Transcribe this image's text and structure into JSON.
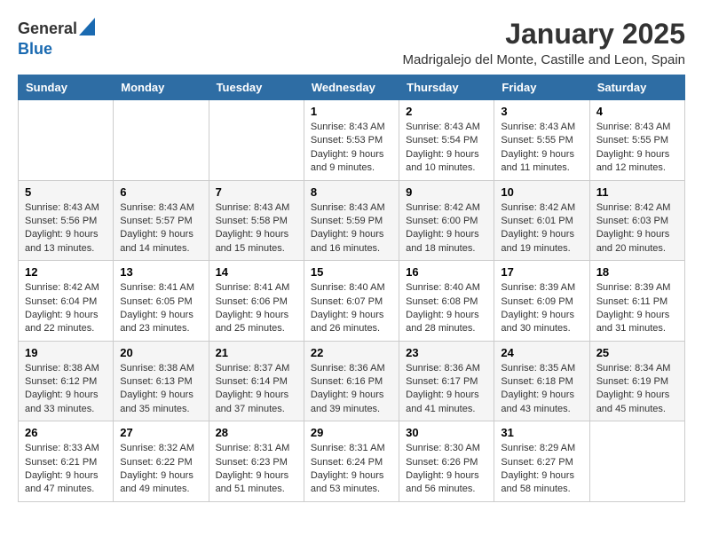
{
  "logo": {
    "general": "General",
    "blue": "Blue"
  },
  "title": "January 2025",
  "subtitle": "Madrigalejo del Monte, Castille and Leon, Spain",
  "weekdays": [
    "Sunday",
    "Monday",
    "Tuesday",
    "Wednesday",
    "Thursday",
    "Friday",
    "Saturday"
  ],
  "weeks": [
    {
      "rowClass": "row-normal",
      "days": [
        {
          "date": "",
          "info": ""
        },
        {
          "date": "",
          "info": ""
        },
        {
          "date": "",
          "info": ""
        },
        {
          "date": "1",
          "info": "Sunrise: 8:43 AM\nSunset: 5:53 PM\nDaylight: 9 hours and 9 minutes."
        },
        {
          "date": "2",
          "info": "Sunrise: 8:43 AM\nSunset: 5:54 PM\nDaylight: 9 hours and 10 minutes."
        },
        {
          "date": "3",
          "info": "Sunrise: 8:43 AM\nSunset: 5:55 PM\nDaylight: 9 hours and 11 minutes."
        },
        {
          "date": "4",
          "info": "Sunrise: 8:43 AM\nSunset: 5:55 PM\nDaylight: 9 hours and 12 minutes."
        }
      ]
    },
    {
      "rowClass": "row-alt",
      "days": [
        {
          "date": "5",
          "info": "Sunrise: 8:43 AM\nSunset: 5:56 PM\nDaylight: 9 hours and 13 minutes."
        },
        {
          "date": "6",
          "info": "Sunrise: 8:43 AM\nSunset: 5:57 PM\nDaylight: 9 hours and 14 minutes."
        },
        {
          "date": "7",
          "info": "Sunrise: 8:43 AM\nSunset: 5:58 PM\nDaylight: 9 hours and 15 minutes."
        },
        {
          "date": "8",
          "info": "Sunrise: 8:43 AM\nSunset: 5:59 PM\nDaylight: 9 hours and 16 minutes."
        },
        {
          "date": "9",
          "info": "Sunrise: 8:42 AM\nSunset: 6:00 PM\nDaylight: 9 hours and 18 minutes."
        },
        {
          "date": "10",
          "info": "Sunrise: 8:42 AM\nSunset: 6:01 PM\nDaylight: 9 hours and 19 minutes."
        },
        {
          "date": "11",
          "info": "Sunrise: 8:42 AM\nSunset: 6:03 PM\nDaylight: 9 hours and 20 minutes."
        }
      ]
    },
    {
      "rowClass": "row-normal",
      "days": [
        {
          "date": "12",
          "info": "Sunrise: 8:42 AM\nSunset: 6:04 PM\nDaylight: 9 hours and 22 minutes."
        },
        {
          "date": "13",
          "info": "Sunrise: 8:41 AM\nSunset: 6:05 PM\nDaylight: 9 hours and 23 minutes."
        },
        {
          "date": "14",
          "info": "Sunrise: 8:41 AM\nSunset: 6:06 PM\nDaylight: 9 hours and 25 minutes."
        },
        {
          "date": "15",
          "info": "Sunrise: 8:40 AM\nSunset: 6:07 PM\nDaylight: 9 hours and 26 minutes."
        },
        {
          "date": "16",
          "info": "Sunrise: 8:40 AM\nSunset: 6:08 PM\nDaylight: 9 hours and 28 minutes."
        },
        {
          "date": "17",
          "info": "Sunrise: 8:39 AM\nSunset: 6:09 PM\nDaylight: 9 hours and 30 minutes."
        },
        {
          "date": "18",
          "info": "Sunrise: 8:39 AM\nSunset: 6:11 PM\nDaylight: 9 hours and 31 minutes."
        }
      ]
    },
    {
      "rowClass": "row-alt",
      "days": [
        {
          "date": "19",
          "info": "Sunrise: 8:38 AM\nSunset: 6:12 PM\nDaylight: 9 hours and 33 minutes."
        },
        {
          "date": "20",
          "info": "Sunrise: 8:38 AM\nSunset: 6:13 PM\nDaylight: 9 hours and 35 minutes."
        },
        {
          "date": "21",
          "info": "Sunrise: 8:37 AM\nSunset: 6:14 PM\nDaylight: 9 hours and 37 minutes."
        },
        {
          "date": "22",
          "info": "Sunrise: 8:36 AM\nSunset: 6:16 PM\nDaylight: 9 hours and 39 minutes."
        },
        {
          "date": "23",
          "info": "Sunrise: 8:36 AM\nSunset: 6:17 PM\nDaylight: 9 hours and 41 minutes."
        },
        {
          "date": "24",
          "info": "Sunrise: 8:35 AM\nSunset: 6:18 PM\nDaylight: 9 hours and 43 minutes."
        },
        {
          "date": "25",
          "info": "Sunrise: 8:34 AM\nSunset: 6:19 PM\nDaylight: 9 hours and 45 minutes."
        }
      ]
    },
    {
      "rowClass": "row-normal",
      "days": [
        {
          "date": "26",
          "info": "Sunrise: 8:33 AM\nSunset: 6:21 PM\nDaylight: 9 hours and 47 minutes."
        },
        {
          "date": "27",
          "info": "Sunrise: 8:32 AM\nSunset: 6:22 PM\nDaylight: 9 hours and 49 minutes."
        },
        {
          "date": "28",
          "info": "Sunrise: 8:31 AM\nSunset: 6:23 PM\nDaylight: 9 hours and 51 minutes."
        },
        {
          "date": "29",
          "info": "Sunrise: 8:31 AM\nSunset: 6:24 PM\nDaylight: 9 hours and 53 minutes."
        },
        {
          "date": "30",
          "info": "Sunrise: 8:30 AM\nSunset: 6:26 PM\nDaylight: 9 hours and 56 minutes."
        },
        {
          "date": "31",
          "info": "Sunrise: 8:29 AM\nSunset: 6:27 PM\nDaylight: 9 hours and 58 minutes."
        },
        {
          "date": "",
          "info": ""
        }
      ]
    }
  ]
}
